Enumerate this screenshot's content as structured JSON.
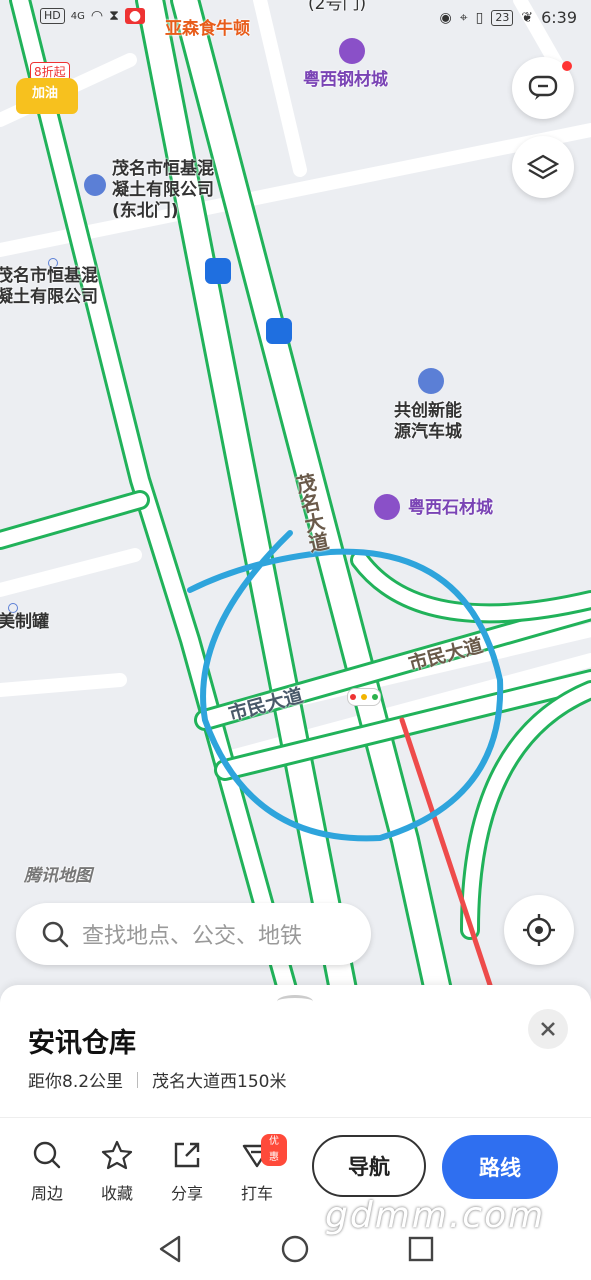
{
  "status_bar": {
    "left_icons": [
      "hd-icon",
      "signal-4g-icon",
      "wifi-icon",
      "hourglass-icon",
      "mic-icon",
      "notification-icons"
    ],
    "hd_label": "HD",
    "network_label": "4G",
    "battery": "23",
    "time": "6:39"
  },
  "map": {
    "top_partial_label": "(2号门)",
    "top_poi_label": "亚森食牛顿",
    "promo": {
      "line1": "8折起",
      "line2": "加油"
    },
    "pois": [
      {
        "name": "粤西钢材城"
      },
      {
        "name": "茂名市恒基混\n凝土有限公司\n(东北门)"
      },
      {
        "name": "茂名市恒基混\n凝土有限公司"
      },
      {
        "name": "共创新能\n源汽车城"
      },
      {
        "name": "粤西石材城"
      },
      {
        "name": "美制罐"
      }
    ],
    "roads": {
      "maoming": "茂名大道",
      "shimin_left": "市民大道",
      "shimin_right": "市民大道"
    },
    "logo": "腾讯地图",
    "colors": {
      "road_green": "#21b25a",
      "road_red": "#ee4b4b",
      "annotation_blue": "#2ea4dc",
      "poi_purple": "#7a44b5"
    }
  },
  "buttons": {
    "chat_icon": "chat-icon",
    "layers_icon": "layers-icon",
    "locate_icon": "locate-icon"
  },
  "search": {
    "placeholder": "查找地点、公交、地铁"
  },
  "place": {
    "title": "安讯仓库",
    "distance": "距你8.2公里",
    "address": "茂名大道西150米"
  },
  "actions": [
    {
      "label": "周边",
      "icon": "search-icon"
    },
    {
      "label": "收藏",
      "icon": "star-icon"
    },
    {
      "label": "分享",
      "icon": "share-icon"
    },
    {
      "label": "打车",
      "icon": "taxi-icon",
      "badge": "优惠"
    }
  ],
  "nav_button": "导航",
  "route_button": "路线",
  "watermark": "gdmm.com"
}
